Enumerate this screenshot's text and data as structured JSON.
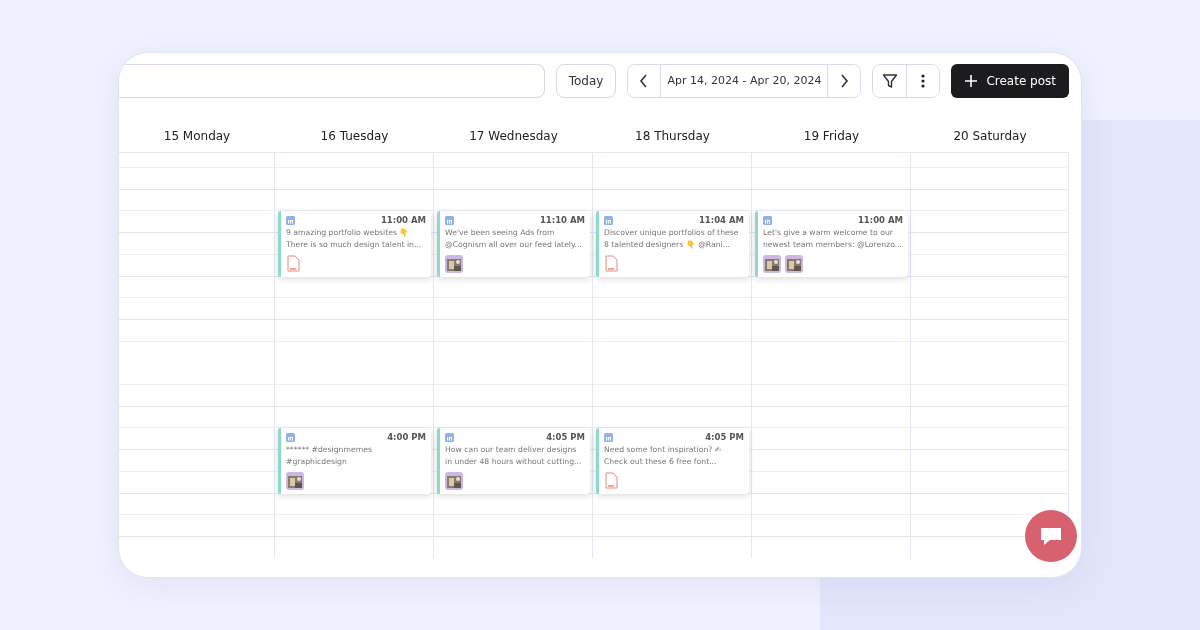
{
  "toolbar": {
    "today": "Today",
    "range": "Apr 14, 2024 - Apr 20, 2024",
    "create": "Create post"
  },
  "days": [
    {
      "label": "15 Monday"
    },
    {
      "label": "16 Tuesday",
      "posts": [
        {
          "time": "11:00 AM",
          "lines": [
            "9 amazing portfolio websites 👇",
            "There is so much design talent in..."
          ],
          "attachments": [
            {
              "kind": "pdf"
            }
          ]
        },
        {
          "time": "4:00 PM",
          "lines": [
            "****** #designmemes",
            "#graphicdesign"
          ]
        }
      ]
    },
    {
      "label": "17 Wednesday",
      "posts": [
        {
          "time": "11:10 AM",
          "lines": [
            "We've been seeing Ads from",
            "@Cognism all over our feed lately..."
          ]
        },
        {
          "time": "4:05 PM",
          "lines": [
            "How can our team deliver designs",
            "in under 48 hours without cutting..."
          ]
        }
      ]
    },
    {
      "label": "18 Thursday",
      "posts": [
        {
          "time": "11:04 AM",
          "lines": [
            "Discover unique portfolios of these",
            "8 talented designers 👇 @Rani..."
          ],
          "attachments": [
            {
              "kind": "pdf"
            }
          ]
        },
        {
          "time": "4:05 PM",
          "lines": [
            "Need some font inspiration? ✍",
            "Check out these 6 free font..."
          ],
          "attachments": [
            {
              "kind": "pdf"
            }
          ]
        }
      ]
    },
    {
      "label": "19 Friday",
      "posts": [
        {
          "time": "11:00 AM",
          "lines": [
            "Let's give a warm welcome to our",
            "newest team members: @Lorenzo..."
          ]
        }
      ]
    },
    {
      "label": "20 Saturday"
    }
  ]
}
